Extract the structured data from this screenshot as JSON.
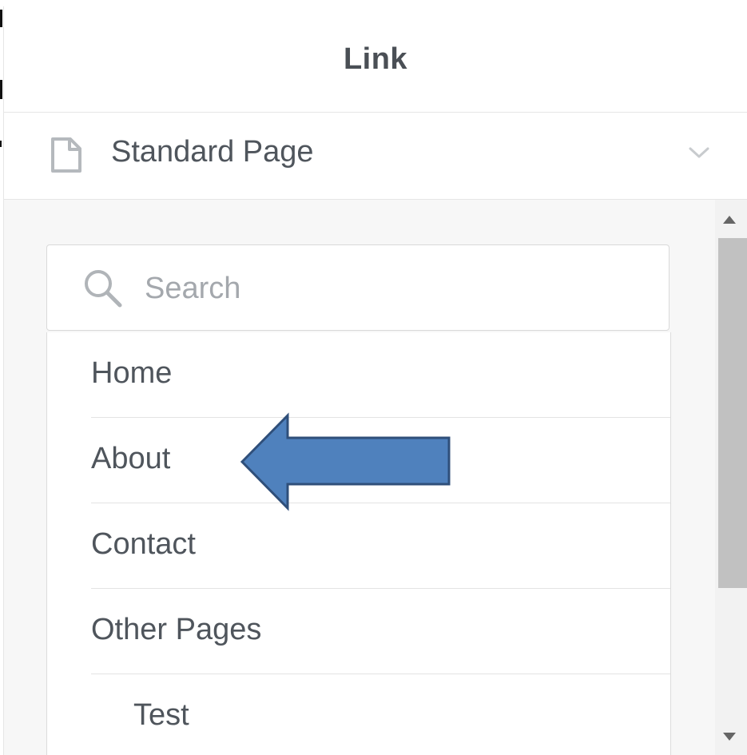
{
  "header": {
    "title": "Link"
  },
  "link_type": {
    "selected": "Standard Page",
    "icon": "document-icon",
    "dropdown_icon": "chevron-down-icon"
  },
  "search": {
    "placeholder": "Search",
    "value": "",
    "icon": "search-icon"
  },
  "pages": [
    {
      "label": "Home",
      "level": 0
    },
    {
      "label": "About",
      "level": 0
    },
    {
      "label": "Contact",
      "level": 0
    },
    {
      "label": "Other Pages",
      "level": 0
    },
    {
      "label": "Test",
      "level": 1
    }
  ],
  "annotation": {
    "type": "arrow",
    "points_to": "About",
    "color": "#4f81bd",
    "stroke": "#2f4f7a"
  },
  "colors": {
    "text": "#4f555c",
    "placeholder": "#a4a8ad",
    "panel_bg": "#f7f7f7",
    "divider": "#e3e3e3"
  }
}
